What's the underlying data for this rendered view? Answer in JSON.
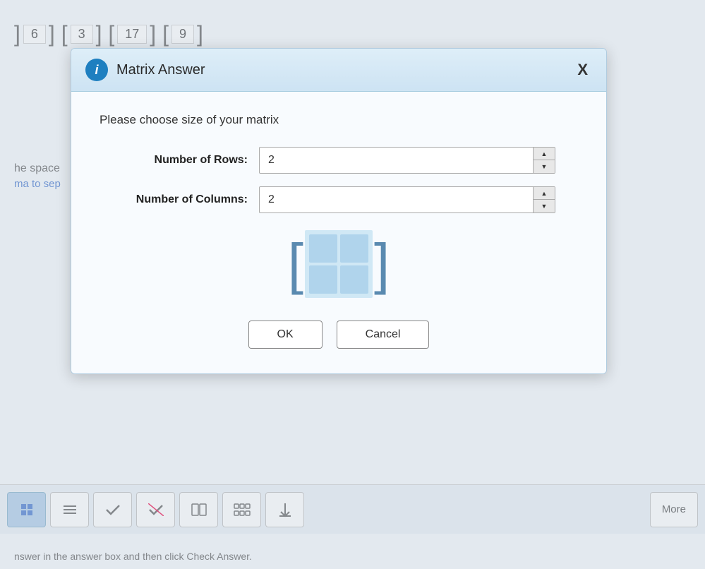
{
  "background": {
    "matrix_numbers": [
      "6",
      "3",
      "17",
      "9"
    ],
    "text_line1": "he space",
    "text_link": "ma to sep",
    "toolbar": {
      "more_label": "More"
    },
    "bottom_text": "nswer in the answer box and then click Check Answer."
  },
  "modal": {
    "title": "Matrix Answer",
    "close_label": "X",
    "info_icon_label": "i",
    "choose_text": "Please choose size of your matrix",
    "rows_label": "Number of Rows:",
    "columns_label": "Number of Columns:",
    "rows_value": "2",
    "columns_value": "2",
    "ok_label": "OK",
    "cancel_label": "Cancel"
  }
}
